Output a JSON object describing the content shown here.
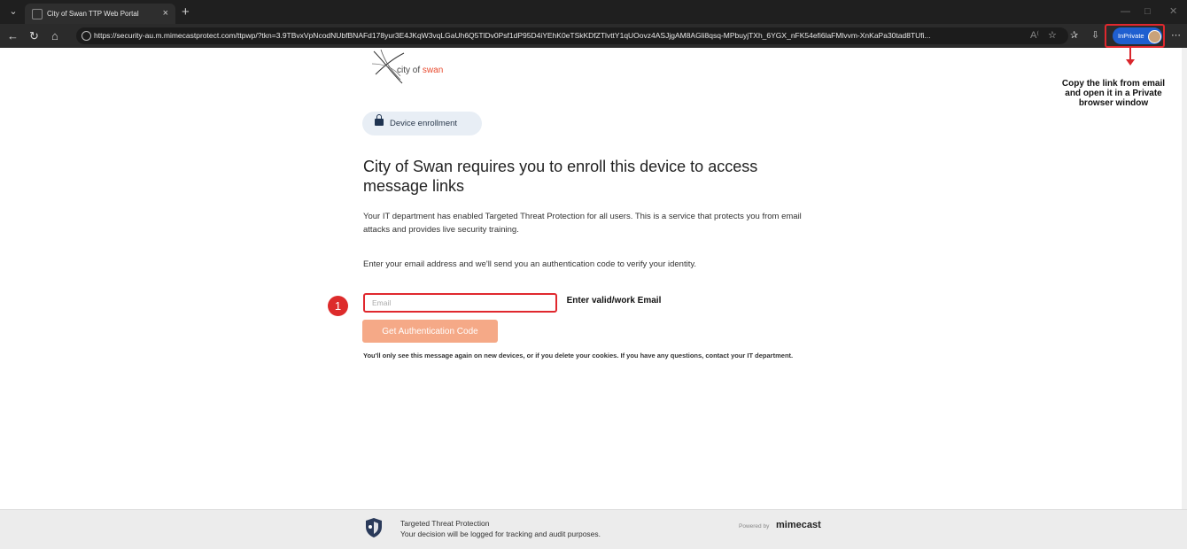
{
  "browser": {
    "tab_title": "City of Swan TTP Web Portal",
    "tab_close": "×",
    "new_tab": "+",
    "url": "https://security-au.m.mimecastprotect.com/ttpwp/?tkn=3.9TBvxVpNcodNUbfBNAFd178yur3E4JKqW3vqLGaUh6Q5TlDv0Psf1dP95D4iYEhK0eTSkKDfZTlvttY1qUOovz4ASJjgAM8AGli8qsq-MPbuyjTXh_6YGX_nFK54efi6laFMlvvm-XnKaPa30tad8TUfi...",
    "inprivate_label": "InPrivate"
  },
  "page": {
    "logo": {
      "prefix": "city of ",
      "brand": "swan"
    },
    "badge": "Device enrollment",
    "headline": "City of Swan requires you to enroll this device to access message links",
    "intro": "Your IT department has enabled Targeted Threat Protection for all users. This is a service that protects you from email attacks and provides live security training.",
    "instruction": "Enter your email address and we'll send you an authentication code to verify your identity.",
    "email": {
      "placeholder": "Email",
      "value": ""
    },
    "button": "Get Authentication Code",
    "note": "You'll only see this message again on new devices, or if you delete your cookies. If you have any questions, contact your IT department."
  },
  "annotations": {
    "step_number": "1",
    "email_hint": "Enter valid/work Email",
    "copy_hint": "Copy the link from email and open it in a Private browser window"
  },
  "footer": {
    "title": "Targeted Threat Protection",
    "subtitle": "Your decision will be logged for tracking and audit purposes.",
    "powered_by": "Powered by",
    "vendor": "mimecast"
  },
  "colors": {
    "button": "#f5a987",
    "annotation_red": "#e0282e",
    "inprivate_blue": "#1f5fd0",
    "brand_orange": "#e84a2e"
  }
}
